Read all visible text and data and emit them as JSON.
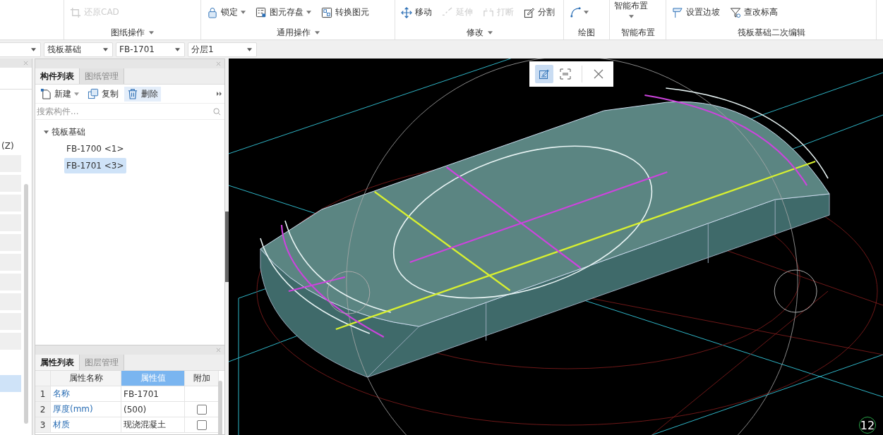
{
  "ribbon": {
    "groups": [
      {
        "label": "图纸操作",
        "has_menu": true,
        "items": [
          {
            "label": "还原CAD",
            "kind": "restore",
            "disabled": true,
            "menu": false
          }
        ]
      },
      {
        "label": "通用操作",
        "has_menu": true,
        "items": [
          {
            "label": "锁定",
            "kind": "lock",
            "disabled": false,
            "menu": true
          },
          {
            "label": "图元存盘",
            "kind": "save",
            "disabled": false,
            "menu": true
          },
          {
            "label": "转换图元",
            "kind": "convert",
            "disabled": false,
            "menu": false
          }
        ]
      },
      {
        "label": "修改",
        "has_menu": true,
        "items": [
          {
            "label": "移动",
            "kind": "move",
            "disabled": false,
            "menu": false
          },
          {
            "label": "延伸",
            "kind": "extend",
            "disabled": true,
            "menu": false
          },
          {
            "label": "打断",
            "kind": "break",
            "disabled": true,
            "menu": false
          },
          {
            "label": "分割",
            "kind": "split",
            "disabled": false,
            "menu": false
          }
        ]
      },
      {
        "label": "绘图",
        "has_menu": false,
        "items": [
          {
            "kind": "arc",
            "disabled": false,
            "menu": true
          }
        ]
      },
      {
        "label": "智能布置",
        "has_menu": false,
        "big": {
          "label": "智能布置",
          "menu": true
        }
      },
      {
        "label": "筏板基础二次编辑",
        "has_menu": false,
        "items": [
          {
            "label": "设置边坡",
            "kind": "slope",
            "disabled": false,
            "menu": false
          },
          {
            "label": "查改标高",
            "kind": "elevation",
            "disabled": false,
            "menu": false
          }
        ]
      }
    ]
  },
  "selectors": [
    {
      "value": "筏板基础"
    },
    {
      "value": "FB-1701"
    },
    {
      "value": "分层1"
    }
  ],
  "left_panel": {
    "text": "(Z)",
    "rows": [
      {
        "selected": false
      },
      {
        "selected": false
      },
      {
        "selected": false
      },
      {
        "selected": false
      },
      {
        "selected": false
      },
      {
        "selected": false
      },
      {
        "selected": false
      },
      {
        "selected": false
      },
      {
        "selected": false
      },
      {
        "selected": false
      },
      {
        "selected": true
      }
    ]
  },
  "component_panel": {
    "tabs": [
      {
        "label": "构件列表",
        "selected": true
      },
      {
        "label": "图纸管理",
        "selected": false
      }
    ],
    "actions": [
      {
        "label": "新建",
        "kind": "new",
        "menu": true,
        "hovered": false
      },
      {
        "label": "复制",
        "kind": "copy",
        "menu": false,
        "hovered": false
      },
      {
        "label": "删除",
        "kind": "delete",
        "menu": false,
        "hovered": true
      }
    ],
    "search": {
      "placeholder": "搜索构件..."
    },
    "tree": [
      {
        "label": "筏板基础",
        "expanded": true,
        "children": [
          {
            "label": "FB-1700 <1>",
            "selected": false
          },
          {
            "label": "FB-1701 <3>",
            "selected": true
          }
        ]
      }
    ]
  },
  "property_panel": {
    "tabs": [
      {
        "label": "属性列表",
        "selected": true
      },
      {
        "label": "图层管理",
        "selected": false
      }
    ],
    "columns": [
      {
        "selected": false
      },
      {
        "label": "属性名称",
        "selected": false
      },
      {
        "label": "属性值",
        "selected": true
      },
      {
        "label": "附加",
        "selected": false
      }
    ],
    "rows": [
      {
        "index": "1",
        "name": "名称",
        "value": "FB-1701",
        "checked": null
      },
      {
        "index": "2",
        "name": "厚度(mm)",
        "value": "(500)",
        "checked": false
      },
      {
        "index": "3",
        "name": "材质",
        "value": "现浇混凝土",
        "checked": false
      }
    ]
  },
  "viewport": {
    "tools": [
      {
        "kind": "edit",
        "selected": true
      },
      {
        "kind": "capture",
        "selected": false
      }
    ],
    "badge": "12"
  }
}
